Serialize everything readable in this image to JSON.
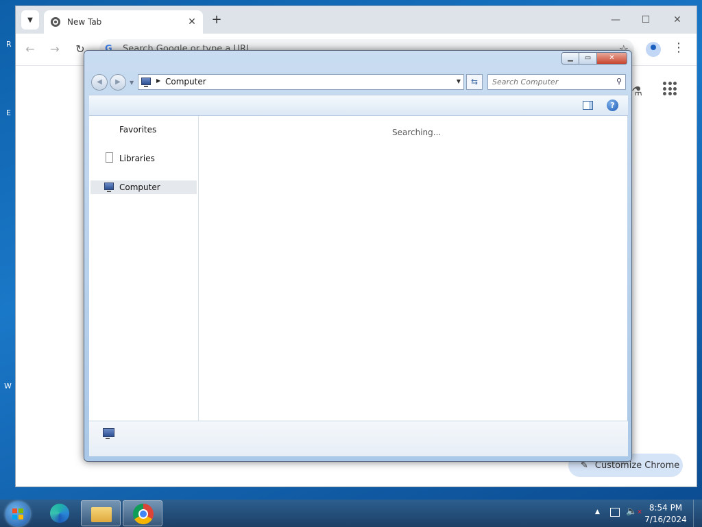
{
  "desktop_fragments": [
    "R",
    "E",
    "W"
  ],
  "chrome": {
    "tab_title": "New Tab",
    "new_tab_symbol": "+",
    "window_controls": {
      "minimize": "—",
      "maximize": "☐",
      "close": "✕"
    },
    "nav": {
      "back": "←",
      "forward": "→",
      "reload": "↻"
    },
    "omnibox_placeholder": "Search Google or type a URL",
    "customize_label": "Customize Chrome"
  },
  "explorer": {
    "caption": {
      "minimize": "▁",
      "maximize": "▭",
      "close": "✕"
    },
    "address": "Computer",
    "search_placeholder": "Search Computer",
    "nav_items": [
      {
        "label": "Favorites"
      },
      {
        "label": "Libraries"
      },
      {
        "label": "Computer",
        "selected": true
      }
    ],
    "status_text": "Searching...",
    "help_symbol": "?"
  },
  "taskbar": {
    "time": "8:54 PM",
    "date": "7/16/2024",
    "tray_arrow": "▲",
    "pinned": [
      "edge-icon",
      "file-explorer-icon",
      "chrome-icon"
    ]
  },
  "colors": {
    "desktop_blue": "#1a78c8",
    "chrome_tabbar": "#dee3ea",
    "explorer_frame": "#aac8e8",
    "taskbar": "#1c3f66",
    "customize_button": "#d6e4f7"
  }
}
